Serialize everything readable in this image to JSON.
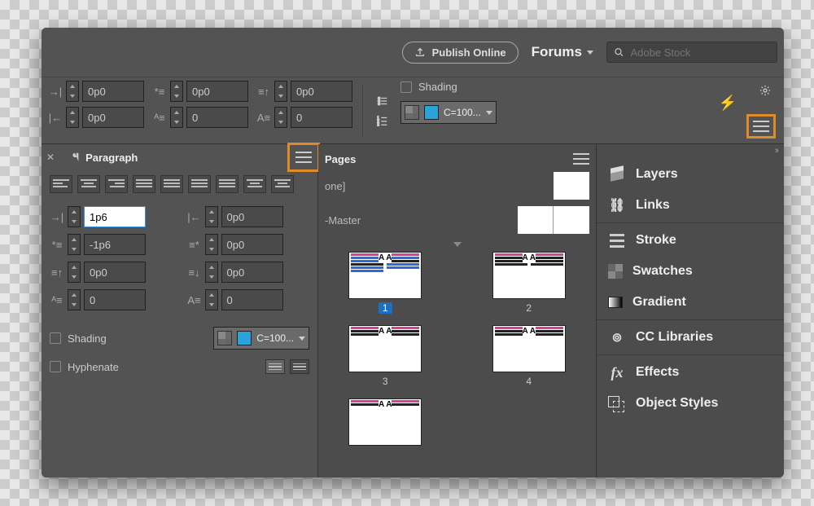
{
  "topbar": {
    "publish_label": "Publish Online",
    "forums_label": "Forums",
    "search_placeholder": "Adobe Stock"
  },
  "ctrl": {
    "r1c1": "0p0",
    "r1c2": "0p0",
    "r1c3": "0p0",
    "r2c1": "0p0",
    "r2c2": "0",
    "r2c3": "0",
    "shading_label": "Shading",
    "swatch_label": "C=100..."
  },
  "paragraph": {
    "title": "Paragraph",
    "left_indent": "1p6",
    "right_indent": "0p0",
    "first_line": "-1p6",
    "last_line": "0p0",
    "space_before": "0p0",
    "space_after": "0p0",
    "drop_lines": "0",
    "drop_chars": "0",
    "shading_label": "Shading",
    "swatch_label": "C=100...",
    "hyphenate_label": "Hyphenate"
  },
  "pages": {
    "title": "Pages",
    "none_label": "[None]",
    "none_visible": "one]",
    "master_label": "A-Master",
    "master_visible": "-Master",
    "nums": [
      "1",
      "2",
      "3",
      "4"
    ]
  },
  "rail": {
    "layers": "Layers",
    "links": "Links",
    "stroke": "Stroke",
    "swatches": "Swatches",
    "gradient": "Gradient",
    "cc": "CC Libraries",
    "effects": "Effects",
    "object_styles": "Object Styles"
  }
}
